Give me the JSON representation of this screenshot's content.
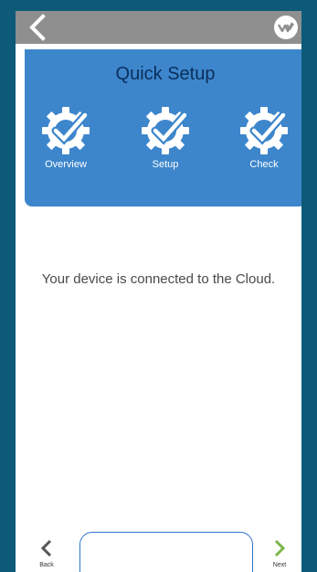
{
  "topbar": {
    "back_icon": "chevron-left-icon",
    "logo_icon": "brand-logo-icon"
  },
  "setup": {
    "title": "Quick Setup",
    "steps": [
      {
        "label": "Overview",
        "icon": "gear-check-icon"
      },
      {
        "label": "Setup",
        "icon": "gear-check-icon"
      },
      {
        "label": "Check",
        "icon": "gear-check-icon"
      }
    ]
  },
  "main": {
    "message": "Your device is connected to the Cloud."
  },
  "footer": {
    "back_label": "Back",
    "next_label": "Next"
  },
  "colors": {
    "panel": "#3d86cc",
    "title": "#0b2f5c",
    "topbar": "#8f8f8f",
    "next_arrow": "#7ab648"
  }
}
